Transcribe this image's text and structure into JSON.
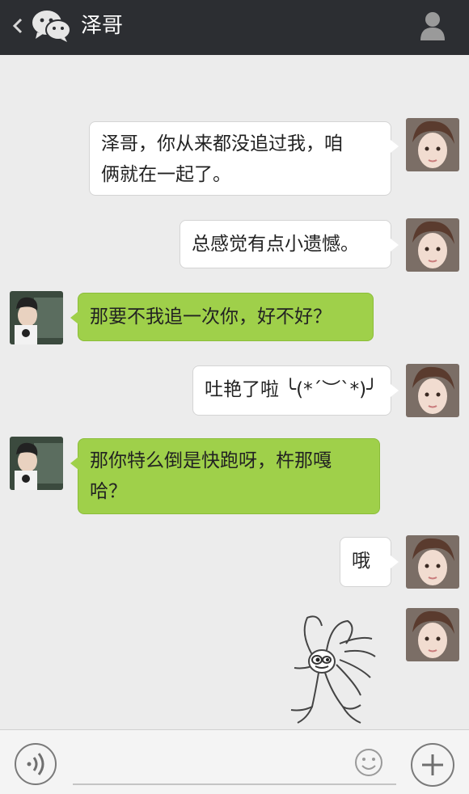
{
  "header": {
    "back_icon": "chevron-left-icon",
    "app_icon": "wechat-icon",
    "title": "泽哥",
    "profile_icon": "person-icon"
  },
  "messages": [
    {
      "sender": "her",
      "text_line1": "泽哥，你从来都没追过我，咱",
      "text_line2": "俩就在一起了。"
    },
    {
      "sender": "her",
      "text": "总感觉有点小遗憾。"
    },
    {
      "sender": "him",
      "text": "那要不我追一次你，好不好？"
    },
    {
      "sender": "her",
      "text": "吐艳了啦 ╰(*´︶`*)╯"
    },
    {
      "sender": "him",
      "text_line1": "那你特么倒是快跑呀，杵那嘎",
      "text_line2": "哈？"
    },
    {
      "sender": "her",
      "text": "哦"
    },
    {
      "sender": "her",
      "sticker": "running-cartoon-sticker"
    }
  ],
  "footer": {
    "voice_icon": "voice-icon",
    "emoji_icon": "smile-icon",
    "plus_icon": "plus-icon"
  },
  "colors": {
    "header_bg": "#2c2e32",
    "chat_bg": "#ececec",
    "green_bubble": "#9fd04a",
    "white_bubble": "#ffffff"
  }
}
